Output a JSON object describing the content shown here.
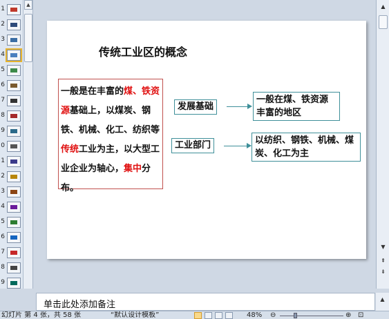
{
  "thumbnails": [
    {
      "num": "1",
      "color": "#c0392b"
    },
    {
      "num": "2",
      "color": "#2e4a7a"
    },
    {
      "num": "3",
      "color": "#3b6ea5"
    },
    {
      "num": "4",
      "color": "#4a7fbf"
    },
    {
      "num": "5",
      "color": "#3d8a4a"
    },
    {
      "num": "6",
      "color": "#7a5a2e"
    },
    {
      "num": "7",
      "color": "#333333"
    },
    {
      "num": "8",
      "color": "#a52a2a"
    },
    {
      "num": "9",
      "color": "#2a6a8a"
    },
    {
      "num": "0",
      "color": "#555555"
    },
    {
      "num": "1",
      "color": "#3a3a8a"
    },
    {
      "num": "2",
      "color": "#b8860b"
    },
    {
      "num": "3",
      "color": "#8b4513"
    },
    {
      "num": "4",
      "color": "#6a1b9a"
    },
    {
      "num": "5",
      "color": "#2e7d32"
    },
    {
      "num": "6",
      "color": "#1565c0"
    },
    {
      "num": "7",
      "color": "#c62828"
    },
    {
      "num": "8",
      "color": "#444444"
    },
    {
      "num": "9",
      "color": "#00695c"
    }
  ],
  "slide": {
    "title": "传统工业区的概念",
    "definition": {
      "p1": "一般是在丰富的",
      "r1": "煤、铁资源",
      "p2": "基础上，以煤炭、钢铁、机械、化工、纺织等",
      "r2": "传统",
      "p3": "工业为主，以大型工业企业为轴心，",
      "r3": "集中",
      "p4": "分布。"
    },
    "label_1": "发展基础",
    "info_1": "一般在煤、铁资源丰富的地区",
    "label_2": "工业部门",
    "info_2": "以纺织、钢铁、机械、煤炭、化工为主"
  },
  "notes": {
    "placeholder": "单击此处添加备注"
  },
  "status": {
    "slide_info": "幻灯片 第 4 张，共 58 张",
    "theme": "“默认设计模板”",
    "zoom": "48%"
  },
  "colors": {
    "highlight_red": "#e01010",
    "box_red": "#c0504d",
    "box_teal": "#3e8f99"
  }
}
